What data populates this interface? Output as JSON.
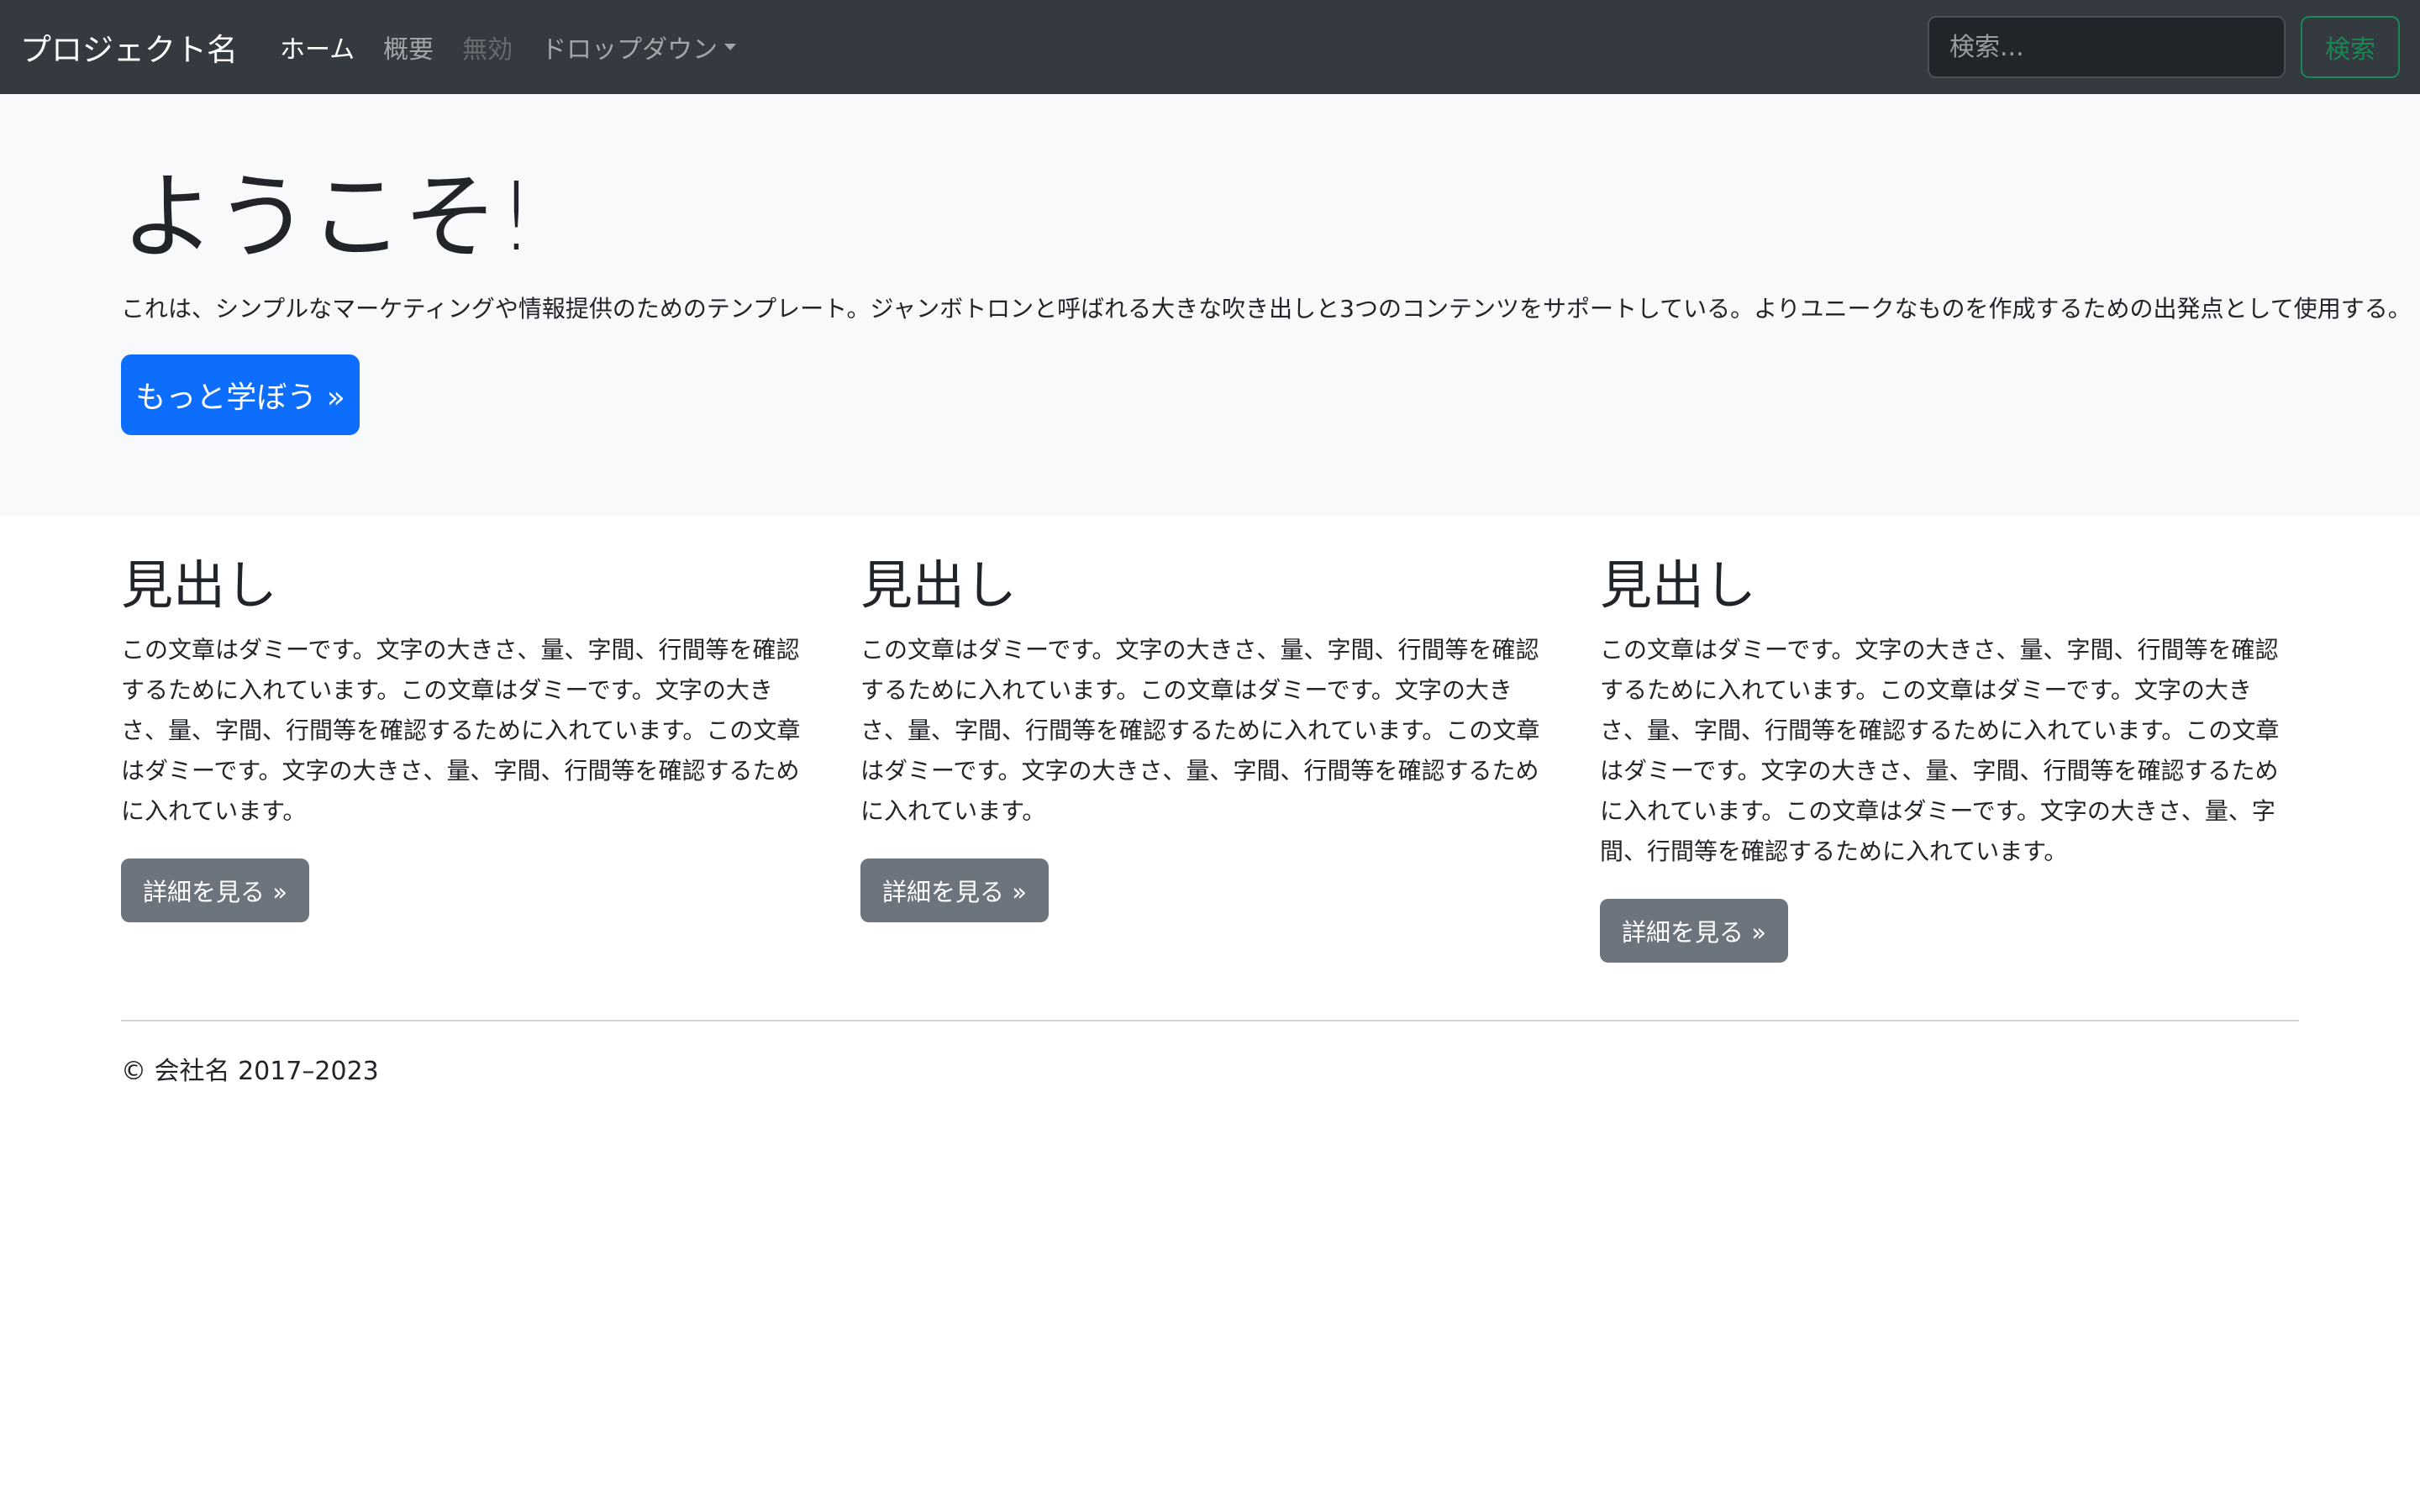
{
  "navbar": {
    "brand": "プロジェクト名",
    "links": [
      {
        "label": "ホーム",
        "state": "active"
      },
      {
        "label": "概要",
        "state": "normal"
      },
      {
        "label": "無効",
        "state": "disabled"
      },
      {
        "label": "ドロップダウン",
        "state": "normal"
      }
    ],
    "search": {
      "placeholder": "検索...",
      "value": "",
      "button_label": "検索"
    }
  },
  "jumbotron": {
    "title": "ようこそ!",
    "lead": "これは、シンプルなマーケティングや情報提供のためのテンプレート。ジャンボトロンと呼ばれる大きな吹き出しと3つのコンテンツをサポートしている。よりユニークなものを作成するための出発点として使用する。",
    "button_label": "もっと学ぼう »"
  },
  "columns": [
    {
      "heading": "見出し",
      "body": "この文章はダミーです。文字の大きさ、量、字間、行間等を確認するために入れています。この文章はダミーです。文字の大きさ、量、字間、行間等を確認するために入れています。この文章はダミーです。文字の大きさ、量、字間、行間等を確認するために入れています。",
      "button_label": "詳細を見る »"
    },
    {
      "heading": "見出し",
      "body": "この文章はダミーです。文字の大きさ、量、字間、行間等を確認するために入れています。この文章はダミーです。文字の大きさ、量、字間、行間等を確認するために入れています。この文章はダミーです。文字の大きさ、量、字間、行間等を確認するために入れています。",
      "button_label": "詳細を見る »"
    },
    {
      "heading": "見出し",
      "body": "この文章はダミーです。文字の大きさ、量、字間、行間等を確認するために入れています。この文章はダミーです。文字の大きさ、量、字間、行間等を確認するために入れています。この文章はダミーです。文字の大きさ、量、字間、行間等を確認するために入れています。この文章はダミーです。文字の大きさ、量、字間、行間等を確認するために入れています。",
      "button_label": "詳細を見る »"
    }
  ],
  "footer": {
    "text": "© 会社名 2017–2023"
  },
  "colors": {
    "navbar_bg": "#343a40",
    "jumbotron_bg": "#f8f9fa",
    "primary": "#0d6efd",
    "secondary": "#6c757d",
    "success": "#198754"
  }
}
